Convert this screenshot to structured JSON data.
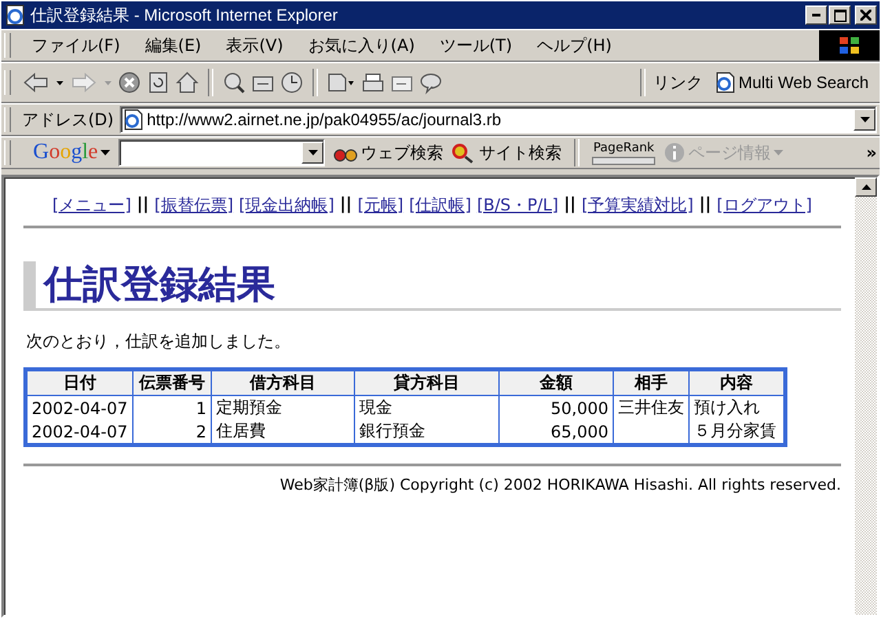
{
  "window": {
    "title": "仕訳登録結果 - Microsoft Internet Explorer"
  },
  "menu": [
    "ファイル(F)",
    "編集(E)",
    "表示(V)",
    "お気に入り(A)",
    "ツール(T)",
    "ヘルプ(H)"
  ],
  "links_bar": {
    "label": "リンク",
    "items": [
      "Multi Web Search"
    ]
  },
  "address": {
    "label": "アドレス(D)",
    "value": "http://www2.airnet.ne.jp/pak04955/ac/journal3.rb"
  },
  "google_bar": {
    "web_search": "ウェブ検索",
    "site_search": "サイト検索",
    "pagerank": "PageRank",
    "page_info": "ページ情報",
    "more": "»",
    "logo": "Google"
  },
  "nav": [
    {
      "kind": "link",
      "label": "[メニュー]"
    },
    {
      "kind": "separator",
      "label": "||"
    },
    {
      "kind": "link",
      "label": "[振替伝票]"
    },
    {
      "kind": "link",
      "label": "[現金出納帳]"
    },
    {
      "kind": "separator",
      "label": "||"
    },
    {
      "kind": "link",
      "label": "[元帳]"
    },
    {
      "kind": "link",
      "label": "[仕訳帳]"
    },
    {
      "kind": "link",
      "label": "[B/S・P/L]"
    },
    {
      "kind": "separator",
      "label": "||"
    },
    {
      "kind": "link",
      "label": "[予算実績対比]"
    },
    {
      "kind": "separator",
      "label": "||"
    },
    {
      "kind": "link",
      "label": "[ログアウト]"
    }
  ],
  "heading": "仕訳登録結果",
  "message": "次のとおり，仕訳を追加しました。",
  "table": {
    "columns": [
      {
        "label": "日付",
        "kind": "text"
      },
      {
        "label": "伝票番号",
        "kind": "number"
      },
      {
        "label": "借方科目",
        "kind": "text"
      },
      {
        "label": "貸方科目",
        "kind": "text"
      },
      {
        "label": "金額",
        "kind": "number"
      },
      {
        "label": "相手",
        "kind": "text"
      },
      {
        "label": "内容",
        "kind": "text"
      }
    ],
    "rows": [
      [
        "2002-04-07",
        "1",
        "定期預金",
        "現金",
        "50,000",
        "三井住友",
        "預け入れ"
      ],
      [
        "2002-04-07",
        "2",
        "住居費",
        "銀行預金",
        "65,000",
        "",
        "５月分家賃"
      ]
    ]
  },
  "footer": "Web家計簿(β版) Copyright (c) 2002 HORIKAWA Hisashi. All rights reserved."
}
